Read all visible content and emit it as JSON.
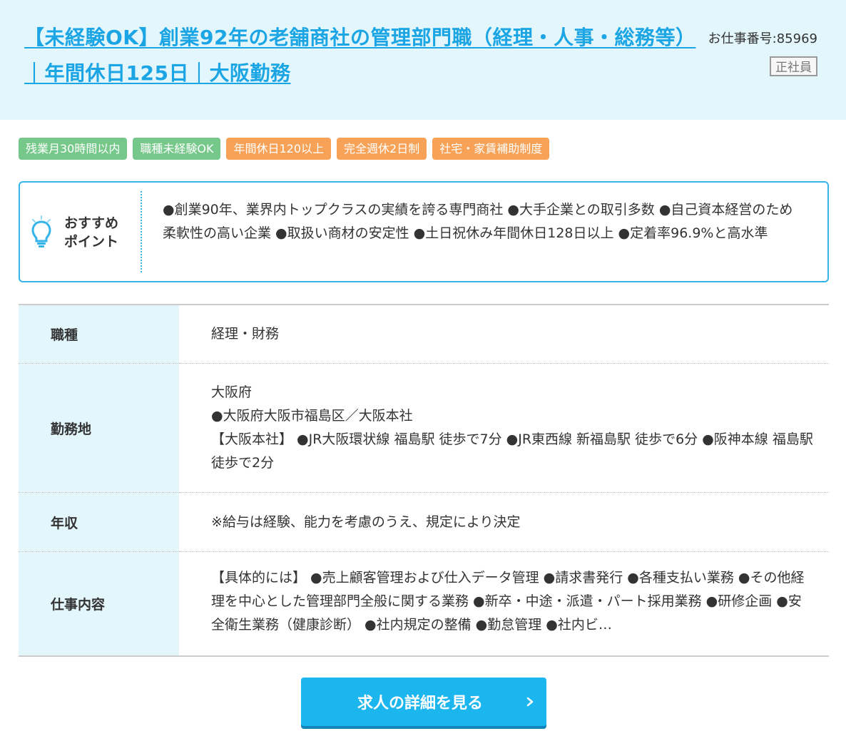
{
  "header": {
    "title": "【未経験OK】創業92年の老舗商社の管理部門職（経理・人事・総務等）｜年間休日125日｜大阪勤務",
    "job_number_label": "お仕事番号:",
    "job_number": "85969",
    "employment_type": "正社員",
    "title_color": "#1ba5e5",
    "background_color": "#e2f6fc"
  },
  "tags": [
    {
      "label": "残業月30時間以内",
      "color": "#76c88a"
    },
    {
      "label": "職種未経験OK",
      "color": "#76c88a"
    },
    {
      "label": "年間休日120以上",
      "color": "#f7a257"
    },
    {
      "label": "完全週休2日制",
      "color": "#f7a257"
    },
    {
      "label": "社宅・家賃補助制度",
      "color": "#f7a257"
    }
  ],
  "recommend": {
    "icon": "lightbulb-icon",
    "label_line1": "おすすめ",
    "label_line2": "ポイント",
    "text": "●創業90年、業界内トップクラスの実績を誇る専門商社 ●大手企業との取引多数 ●自己資本経営のため柔軟性の高い企業 ●取扱い商材の安定性 ●土日祝休み年間休日128日以上 ●定着率96.9%と高水準",
    "border_color": "#35b4ea"
  },
  "info": {
    "job_type": {
      "label": "職種",
      "value": "経理・財務"
    },
    "location": {
      "label": "勤務地",
      "line1": "大阪府",
      "line2": "●大阪府大阪市福島区／大阪本社",
      "line3": "【大阪本社】 ●JR大阪環状線 福島駅 徒歩で7分 ●JR東西線 新福島駅 徒歩で6分 ●阪神本線 福島駅 徒歩で2分"
    },
    "salary": {
      "label": "年収",
      "value": "※給与は経験、能力を考慮のうえ、規定により決定"
    },
    "duties": {
      "label": "仕事内容",
      "value": "【具体的には】 ●売上顧客管理および仕入データ管理 ●請求書発行 ●各種支払い業務 ●その他経理を中心とした管理部門全般に関する業務 ●新卒・中途・派遣・パート採用業務 ●研修企画 ●安全衛生業務（健康診断） ●社内規定の整備 ●勤怠管理 ●社内ビ…"
    }
  },
  "cta": {
    "label": "求人の詳細を見る",
    "icon": "chevron-right-icon",
    "color": "#1cb6ee"
  }
}
